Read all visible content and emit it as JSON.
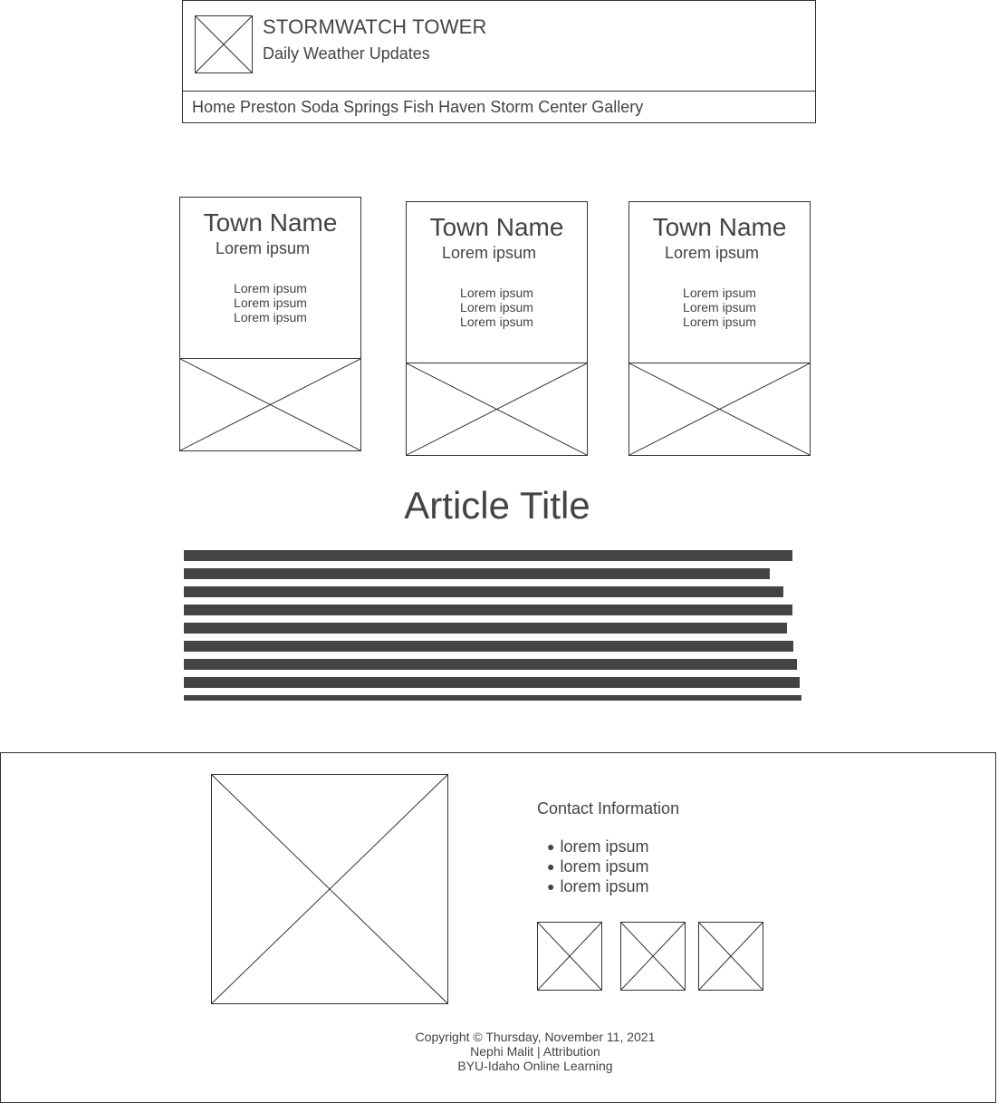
{
  "header": {
    "title": "STORMWATCH TOWER",
    "subtitle": "Daily Weather Updates",
    "logo_icon": "image-placeholder-icon"
  },
  "nav": {
    "items": [
      {
        "label": "Home"
      },
      {
        "label": "Preston"
      },
      {
        "label": "Soda Springs"
      },
      {
        "label": "Fish Haven"
      },
      {
        "label": "Storm Center"
      },
      {
        "label": "Gallery"
      }
    ]
  },
  "towns": [
    {
      "name": "Town Name",
      "subtitle": "Lorem ipsum",
      "details": [
        "Lorem ipsum",
        "Lorem ipsum",
        "Lorem ipsum"
      ]
    },
    {
      "name": "Town Name",
      "subtitle": "Lorem ipsum",
      "details": [
        "Lorem ipsum",
        "Lorem ipsum",
        "Lorem ipsum"
      ]
    },
    {
      "name": "Town Name",
      "subtitle": "Lorem ipsum",
      "details": [
        "Lorem ipsum",
        "Lorem ipsum",
        "Lorem ipsum"
      ]
    }
  ],
  "article": {
    "title": "Article Title",
    "text_line_count": 9
  },
  "footer": {
    "contact_heading": "Contact Information",
    "contact_items": [
      "lorem ipsum",
      "lorem ipsum",
      "lorem ipsum"
    ],
    "social_icons": [
      "image-placeholder-icon",
      "image-placeholder-icon",
      "image-placeholder-icon"
    ],
    "copyright_lines": [
      "Copyright © Thursday, November 11, 2021",
      "Nephi Malit | Attribution",
      "BYU-Idaho Online Learning"
    ]
  },
  "colors": {
    "text": "#444444",
    "border": "#333333",
    "background": "#ffffff",
    "text_bar": "#444444"
  }
}
